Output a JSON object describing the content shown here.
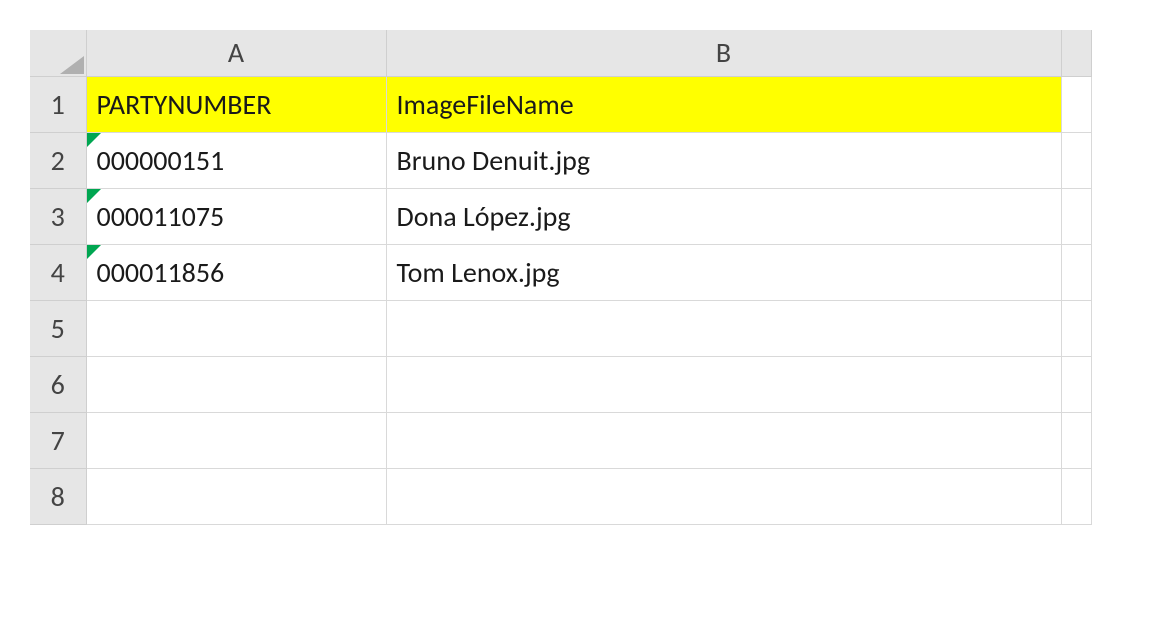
{
  "columns": {
    "a": "A",
    "b": "B"
  },
  "row_numbers": [
    "1",
    "2",
    "3",
    "4",
    "5",
    "6",
    "7",
    "8"
  ],
  "headers": {
    "a": "PARTYNUMBER",
    "b": "ImageFileName"
  },
  "rows": [
    {
      "a": "000000151",
      "b": "Bruno Denuit.jpg"
    },
    {
      "a": "000011075",
      "b": "Dona López.jpg"
    },
    {
      "a": "000011856",
      "b": "Tom Lenox.jpg"
    }
  ]
}
